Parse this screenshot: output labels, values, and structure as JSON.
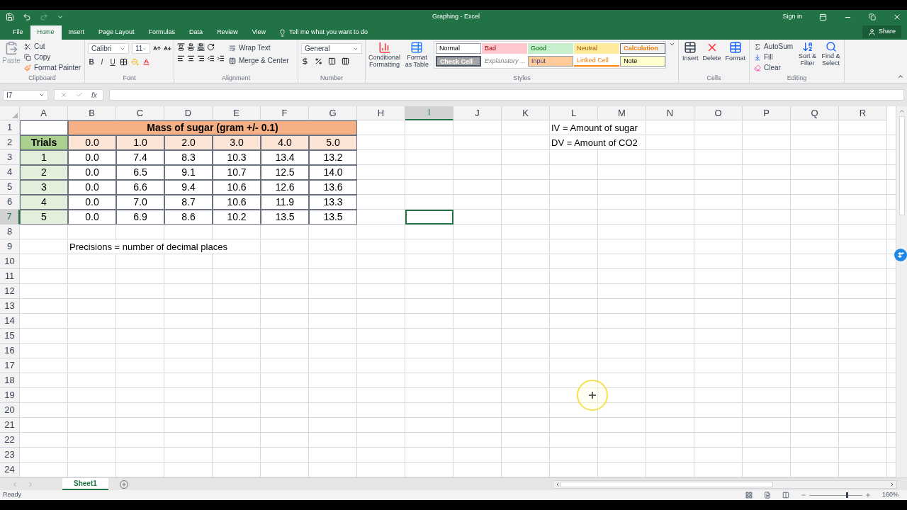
{
  "window": {
    "title": "Graphing - Excel",
    "sign_in": "Sign in"
  },
  "ribbon_tabs": [
    {
      "label": "File",
      "selected": false
    },
    {
      "label": "Home",
      "selected": true
    },
    {
      "label": "Insert",
      "selected": false
    },
    {
      "label": "Page Layout",
      "selected": false
    },
    {
      "label": "Formulas",
      "selected": false
    },
    {
      "label": "Data",
      "selected": false
    },
    {
      "label": "Review",
      "selected": false
    },
    {
      "label": "View",
      "selected": false
    }
  ],
  "tell_me": "Tell me what you want to do",
  "share": "Share",
  "clipboard": {
    "paste": "Paste",
    "cut": "Cut",
    "copy": "Copy",
    "format_painter": "Format Painter",
    "label": "Clipboard"
  },
  "font": {
    "name": "Calibri",
    "size": "11",
    "format_buttons": [
      "B",
      "I",
      "U"
    ],
    "label": "Font"
  },
  "alignment": {
    "wrap_text": "Wrap Text",
    "merge_center": "Merge & Center",
    "label": "Alignment"
  },
  "number": {
    "format": "General",
    "label": "Number"
  },
  "styles": {
    "conditional_formatting": "Conditional Formatting",
    "format_as_table": "Format as Table",
    "label": "Styles",
    "cell_styles": [
      {
        "label": "Normal",
        "kind": "normal"
      },
      {
        "label": "Bad",
        "kind": "bad"
      },
      {
        "label": "Good",
        "kind": "good"
      },
      {
        "label": "Neutral",
        "kind": "neutral"
      },
      {
        "label": "Calculation",
        "kind": "calculation"
      },
      {
        "label": "Check Cell",
        "kind": "check"
      },
      {
        "label": "Explanatory ...",
        "kind": "explanatory"
      },
      {
        "label": "Input",
        "kind": "input"
      },
      {
        "label": "Linked Cell",
        "kind": "linked"
      },
      {
        "label": "Note",
        "kind": "note"
      }
    ]
  },
  "cells_group": {
    "insert": "Insert",
    "delete": "Delete",
    "format": "Format",
    "label": "Cells"
  },
  "editing": {
    "autosum": "AutoSum",
    "fill": "Fill",
    "clear": "Clear",
    "sort_filter": "Sort & Filter",
    "find_select": "Find & Select",
    "label": "Editing"
  },
  "formula_bar": {
    "name_box": "I7",
    "fx": "fx"
  },
  "sheet": {
    "columns": [
      {
        "label": "A",
        "selected": false
      },
      {
        "label": "B",
        "selected": false
      },
      {
        "label": "C",
        "selected": false
      },
      {
        "label": "D",
        "selected": false
      },
      {
        "label": "E",
        "selected": false
      },
      {
        "label": "F",
        "selected": false
      },
      {
        "label": "G",
        "selected": false
      },
      {
        "label": "H",
        "selected": false
      },
      {
        "label": "I",
        "selected": true
      },
      {
        "label": "J",
        "selected": false
      },
      {
        "label": "K",
        "selected": false
      },
      {
        "label": "L",
        "selected": false
      },
      {
        "label": "M",
        "selected": false
      },
      {
        "label": "N",
        "selected": false
      },
      {
        "label": "O",
        "selected": false
      },
      {
        "label": "P",
        "selected": false
      },
      {
        "label": "Q",
        "selected": false
      },
      {
        "label": "R",
        "selected": false
      }
    ],
    "rows": [
      {
        "label": "1",
        "selected": false,
        "cells": [
          {
            "text": "",
            "kind": "blank"
          },
          {
            "text": "Mass of sugar (gram +/- 0.1)",
            "kind": "title"
          },
          {
            "text": "",
            "kind": "empty"
          },
          {
            "text": "",
            "kind": "empty"
          },
          {
            "text": "",
            "kind": "empty"
          },
          {
            "text": "",
            "kind": "empty"
          },
          {
            "text": "",
            "kind": "empty"
          },
          {
            "text": "",
            "kind": "empty"
          },
          {
            "text": "",
            "kind": "empty"
          },
          {
            "text": "",
            "kind": "empty"
          },
          {
            "text": "",
            "kind": "empty"
          },
          {
            "text": "IV = Amount of sugar",
            "kind": "note"
          }
        ]
      },
      {
        "label": "2",
        "selected": false,
        "cells": [
          {
            "text": "Trials",
            "kind": "heading"
          },
          {
            "text": "0.0",
            "kind": "mass"
          },
          {
            "text": "1.0",
            "kind": "mass"
          },
          {
            "text": "2.0",
            "kind": "mass"
          },
          {
            "text": "3.0",
            "kind": "mass"
          },
          {
            "text": "4.0",
            "kind": "mass"
          },
          {
            "text": "5.0",
            "kind": "mass"
          },
          {
            "text": "",
            "kind": "empty"
          },
          {
            "text": "",
            "kind": "empty"
          },
          {
            "text": "",
            "kind": "empty"
          },
          {
            "text": "",
            "kind": "empty"
          },
          {
            "text": "DV = Amount of CO2",
            "kind": "note"
          }
        ]
      },
      {
        "label": "3",
        "selected": false,
        "cells": [
          {
            "text": "1",
            "kind": "trial"
          },
          {
            "text": "0.0",
            "kind": "value"
          },
          {
            "text": "7.4",
            "kind": "value"
          },
          {
            "text": "8.3",
            "kind": "value"
          },
          {
            "text": "10.3",
            "kind": "value"
          },
          {
            "text": "13.4",
            "kind": "value"
          },
          {
            "text": "13.2",
            "kind": "value"
          }
        ]
      },
      {
        "label": "4",
        "selected": false,
        "cells": [
          {
            "text": "2",
            "kind": "trial"
          },
          {
            "text": "0.0",
            "kind": "value"
          },
          {
            "text": "6.5",
            "kind": "value"
          },
          {
            "text": "9.1",
            "kind": "value"
          },
          {
            "text": "10.7",
            "kind": "value"
          },
          {
            "text": "12.5",
            "kind": "value"
          },
          {
            "text": "14.0",
            "kind": "value"
          }
        ]
      },
      {
        "label": "5",
        "selected": false,
        "cells": [
          {
            "text": "3",
            "kind": "trial"
          },
          {
            "text": "0.0",
            "kind": "value"
          },
          {
            "text": "6.6",
            "kind": "value"
          },
          {
            "text": "9.4",
            "kind": "value"
          },
          {
            "text": "10.6",
            "kind": "value"
          },
          {
            "text": "12.6",
            "kind": "value"
          },
          {
            "text": "13.6",
            "kind": "value"
          }
        ]
      },
      {
        "label": "6",
        "selected": false,
        "cells": [
          {
            "text": "4",
            "kind": "trial"
          },
          {
            "text": "0.0",
            "kind": "value"
          },
          {
            "text": "7.0",
            "kind": "value"
          },
          {
            "text": "8.7",
            "kind": "value"
          },
          {
            "text": "10.6",
            "kind": "value"
          },
          {
            "text": "11.9",
            "kind": "value"
          },
          {
            "text": "13.3",
            "kind": "value"
          }
        ]
      },
      {
        "label": "7",
        "selected": true,
        "cells": [
          {
            "text": "5",
            "kind": "trial"
          },
          {
            "text": "0.0",
            "kind": "value"
          },
          {
            "text": "6.9",
            "kind": "value"
          },
          {
            "text": "8.6",
            "kind": "value"
          },
          {
            "text": "10.2",
            "kind": "value"
          },
          {
            "text": "13.5",
            "kind": "value"
          },
          {
            "text": "13.5",
            "kind": "value"
          }
        ]
      },
      {
        "label": "8",
        "selected": false,
        "cells": []
      },
      {
        "label": "9",
        "selected": false,
        "cells": [
          {
            "text": "",
            "kind": "empty"
          },
          {
            "text": "Precisions = number of decimal places",
            "kind": "note"
          }
        ]
      },
      {
        "label": "10",
        "selected": false,
        "cells": []
      },
      {
        "label": "11",
        "selected": false,
        "cells": []
      },
      {
        "label": "12",
        "selected": false,
        "cells": []
      },
      {
        "label": "13",
        "selected": false,
        "cells": []
      },
      {
        "label": "14",
        "selected": false,
        "cells": []
      },
      {
        "label": "15",
        "selected": false,
        "cells": []
      },
      {
        "label": "16",
        "selected": false,
        "cells": []
      },
      {
        "label": "17",
        "selected": false,
        "cells": []
      },
      {
        "label": "18",
        "selected": false,
        "cells": []
      },
      {
        "label": "19",
        "selected": false,
        "cells": []
      },
      {
        "label": "20",
        "selected": false,
        "cells": []
      },
      {
        "label": "21",
        "selected": false,
        "cells": []
      },
      {
        "label": "22",
        "selected": false,
        "cells": []
      },
      {
        "label": "23",
        "selected": false,
        "cells": []
      },
      {
        "label": "24",
        "selected": false,
        "cells": []
      }
    ]
  },
  "sheet_tabs": [
    {
      "label": "Sheet1",
      "selected": true
    }
  ],
  "status": {
    "text": "Ready",
    "zoom": "160%",
    "zoom_level": {
      "level": 0.72
    }
  }
}
